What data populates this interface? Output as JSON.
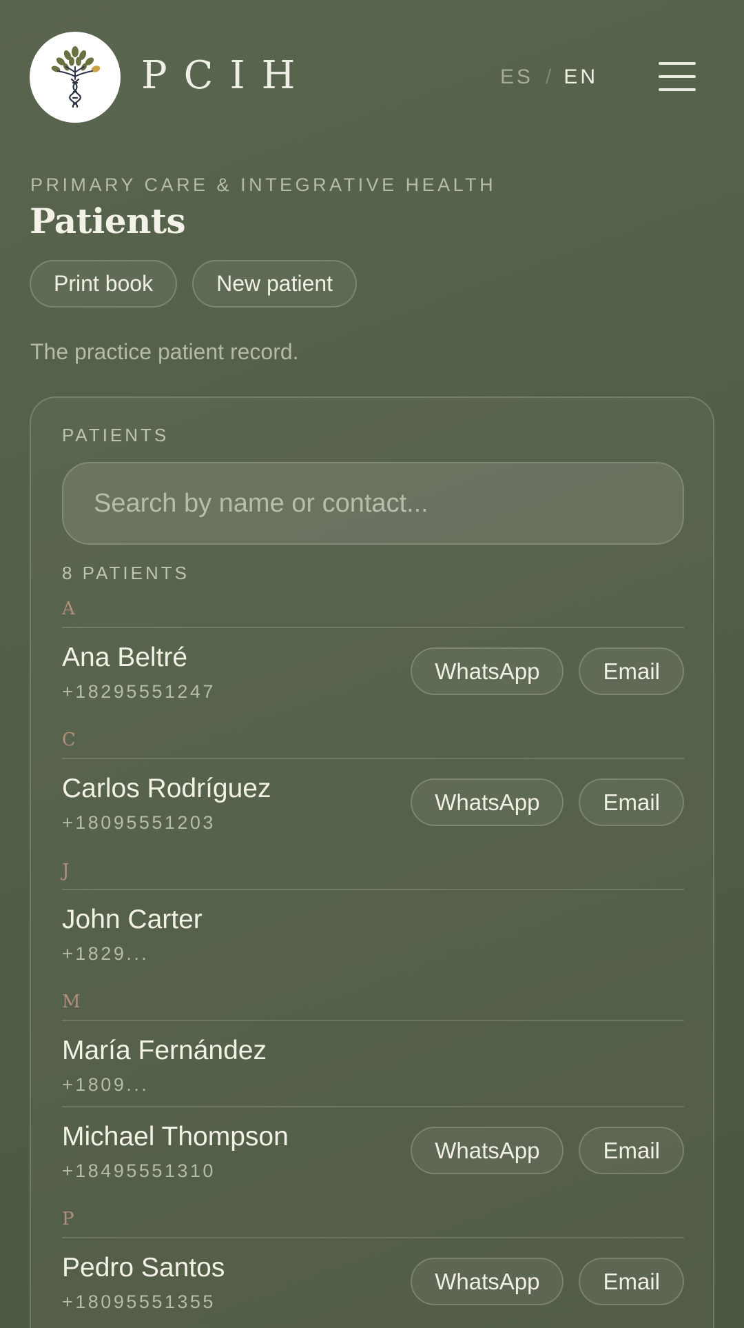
{
  "header": {
    "brand": "PCIH",
    "lang_es": "ES",
    "lang_sep": "/",
    "lang_en": "EN"
  },
  "page": {
    "eyebrow": "PRIMARY CARE & INTEGRATIVE HEALTH",
    "title": "Patients",
    "actions": {
      "print": "Print book",
      "new": "New patient"
    },
    "subtitle": "The practice patient record."
  },
  "card": {
    "label": "PATIENTS",
    "search_placeholder": "Search by name or contact...",
    "count": "8 PATIENTS"
  },
  "groups": [
    {
      "letter": "A",
      "patients": [
        {
          "name": "Ana Beltré",
          "phone": "+18295551247",
          "whatsapp": "WhatsApp",
          "email": "Email"
        }
      ]
    },
    {
      "letter": "C",
      "patients": [
        {
          "name": "Carlos Rodríguez",
          "phone": "+18095551203",
          "whatsapp": "WhatsApp",
          "email": "Email"
        }
      ]
    },
    {
      "letter": "J",
      "patients": [
        {
          "name": "John Carter",
          "phone": "+1829..."
        }
      ]
    },
    {
      "letter": "M",
      "patients": [
        {
          "name": "María Fernández",
          "phone": "+1809..."
        },
        {
          "name": "Michael Thompson",
          "phone": "+18495551310",
          "whatsapp": "WhatsApp",
          "email": "Email"
        }
      ]
    },
    {
      "letter": "P",
      "patients": [
        {
          "name": "Pedro Santos",
          "phone": "+18095551355",
          "whatsapp": "WhatsApp",
          "email": "Email"
        }
      ]
    }
  ],
  "colors": {
    "background": "#545f49",
    "accent_letter": "#b08f7c",
    "text": "#f2f1e6",
    "muted": "#b7bba9"
  }
}
